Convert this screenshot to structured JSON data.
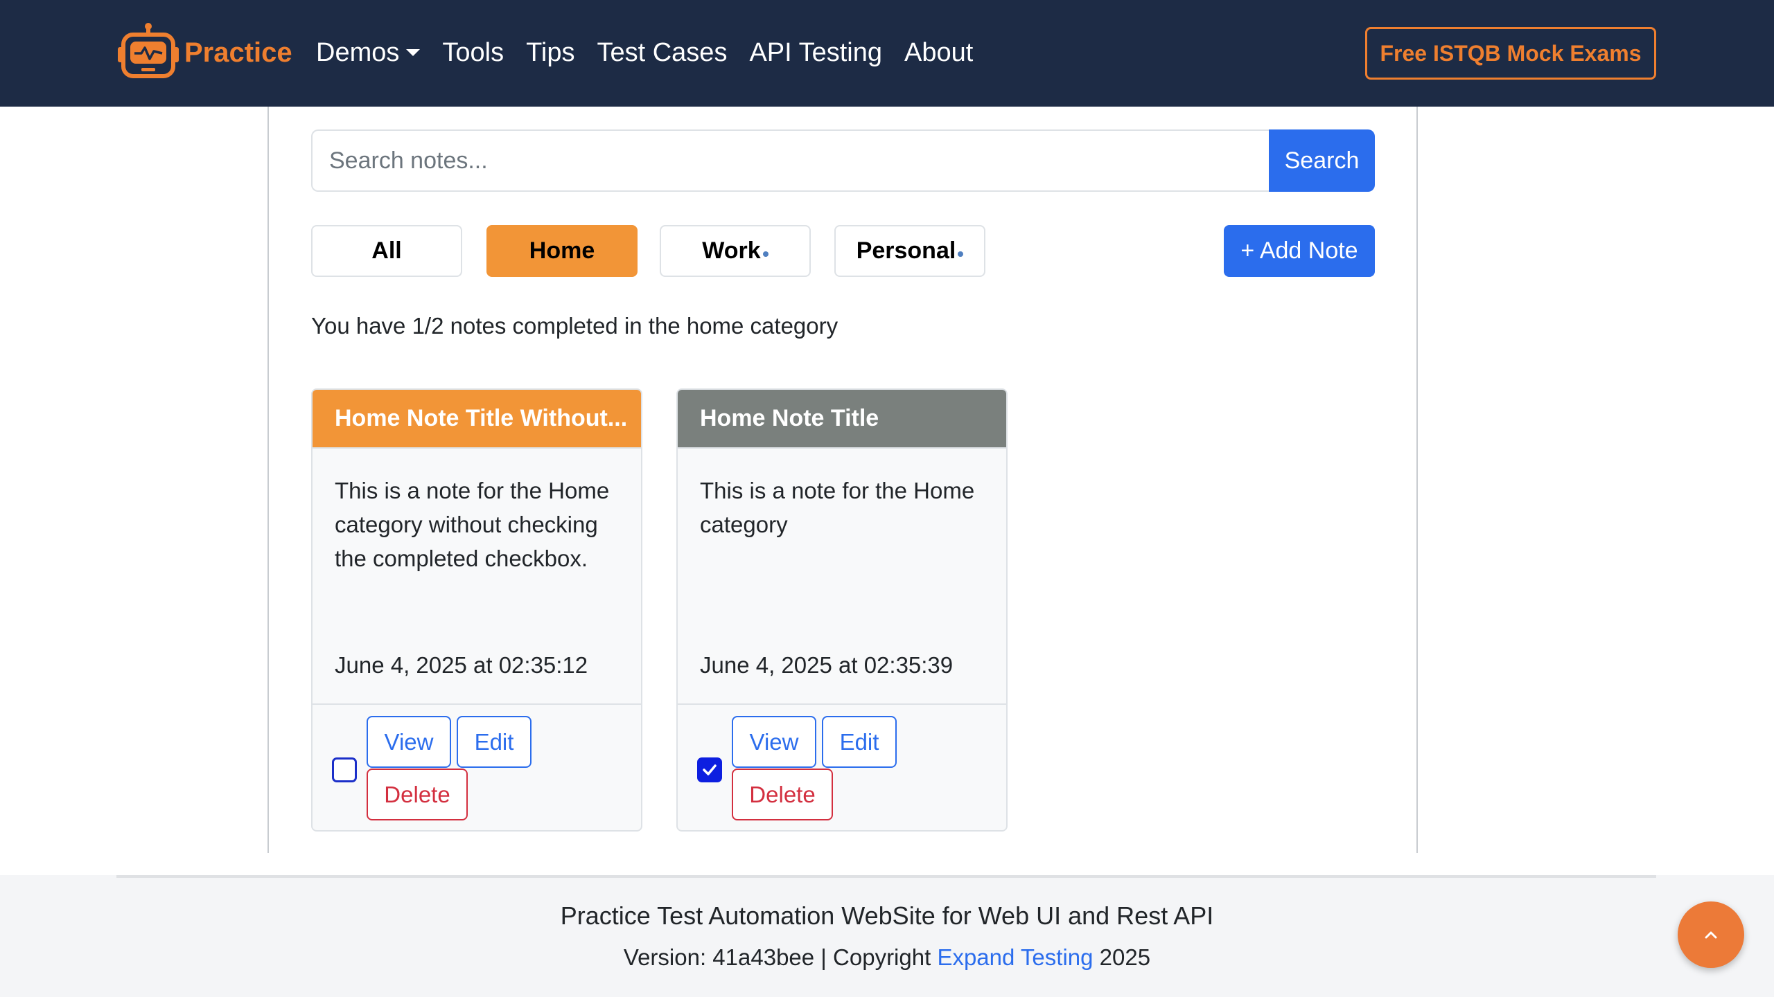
{
  "colors": {
    "navbar": "#1d2b45",
    "brand": "#ef7f2f",
    "primary": "#2b6ded",
    "home_category": "#f29537",
    "completed_header": "#7a807d",
    "danger": "#d32f3f"
  },
  "navbar": {
    "brand": "Practice",
    "links": {
      "demos": "Demos",
      "tools": "Tools",
      "tips": "Tips",
      "test_cases": "Test Cases",
      "api_testing": "API Testing",
      "about": "About"
    },
    "cta": "Free ISTQB Mock Exams"
  },
  "search": {
    "placeholder": "Search notes...",
    "value": "",
    "button": "Search"
  },
  "categories": {
    "all": "All",
    "home": "Home",
    "work": "Work",
    "personal": "Personal",
    "selected": "Home"
  },
  "add_note": "+ Add Note",
  "progress": "You have 1/2 notes completed in the home category",
  "notes": [
    {
      "title": "Home Note Title Without...",
      "description": "This is a note for the Home category without checking the completed checkbox.",
      "date": "June 4, 2025 at 02:35:12",
      "completed": false,
      "view": "View",
      "edit": "Edit",
      "delete": "Delete"
    },
    {
      "title": "Home Note Title",
      "description": "This is a note for the Home category",
      "date": "June 4, 2025 at 02:35:39",
      "completed": true,
      "view": "View",
      "edit": "Edit",
      "delete": "Delete"
    }
  ],
  "footer": {
    "title": "Practice Test Automation WebSite for Web UI and Rest API",
    "version_prefix": "Version: 41a43bee | Copyright ",
    "link": "Expand Testing",
    "year": " 2025"
  }
}
